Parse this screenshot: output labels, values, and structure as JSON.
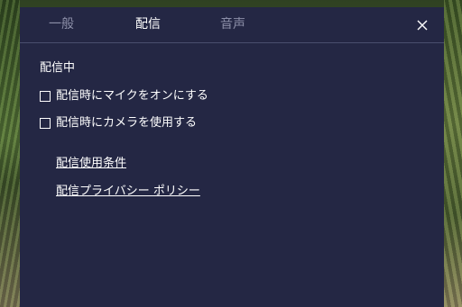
{
  "tabs": [
    {
      "label": "一般",
      "active": false
    },
    {
      "label": "配信",
      "active": true
    },
    {
      "label": "音声",
      "active": false
    }
  ],
  "close_icon": "close-icon",
  "section": {
    "title": "配信中"
  },
  "options": [
    {
      "label": "配信時にマイクをオンにする",
      "checked": false
    },
    {
      "label": "配信時にカメラを使用する",
      "checked": false
    }
  ],
  "links": [
    {
      "label": "配信使用条件"
    },
    {
      "label": "配信プライバシー ポリシー"
    }
  ],
  "colors": {
    "panel_bg": "#242744",
    "text": "#ffffff",
    "inactive_tab": "#8c8fa8",
    "divider": "#4a4e6e"
  }
}
